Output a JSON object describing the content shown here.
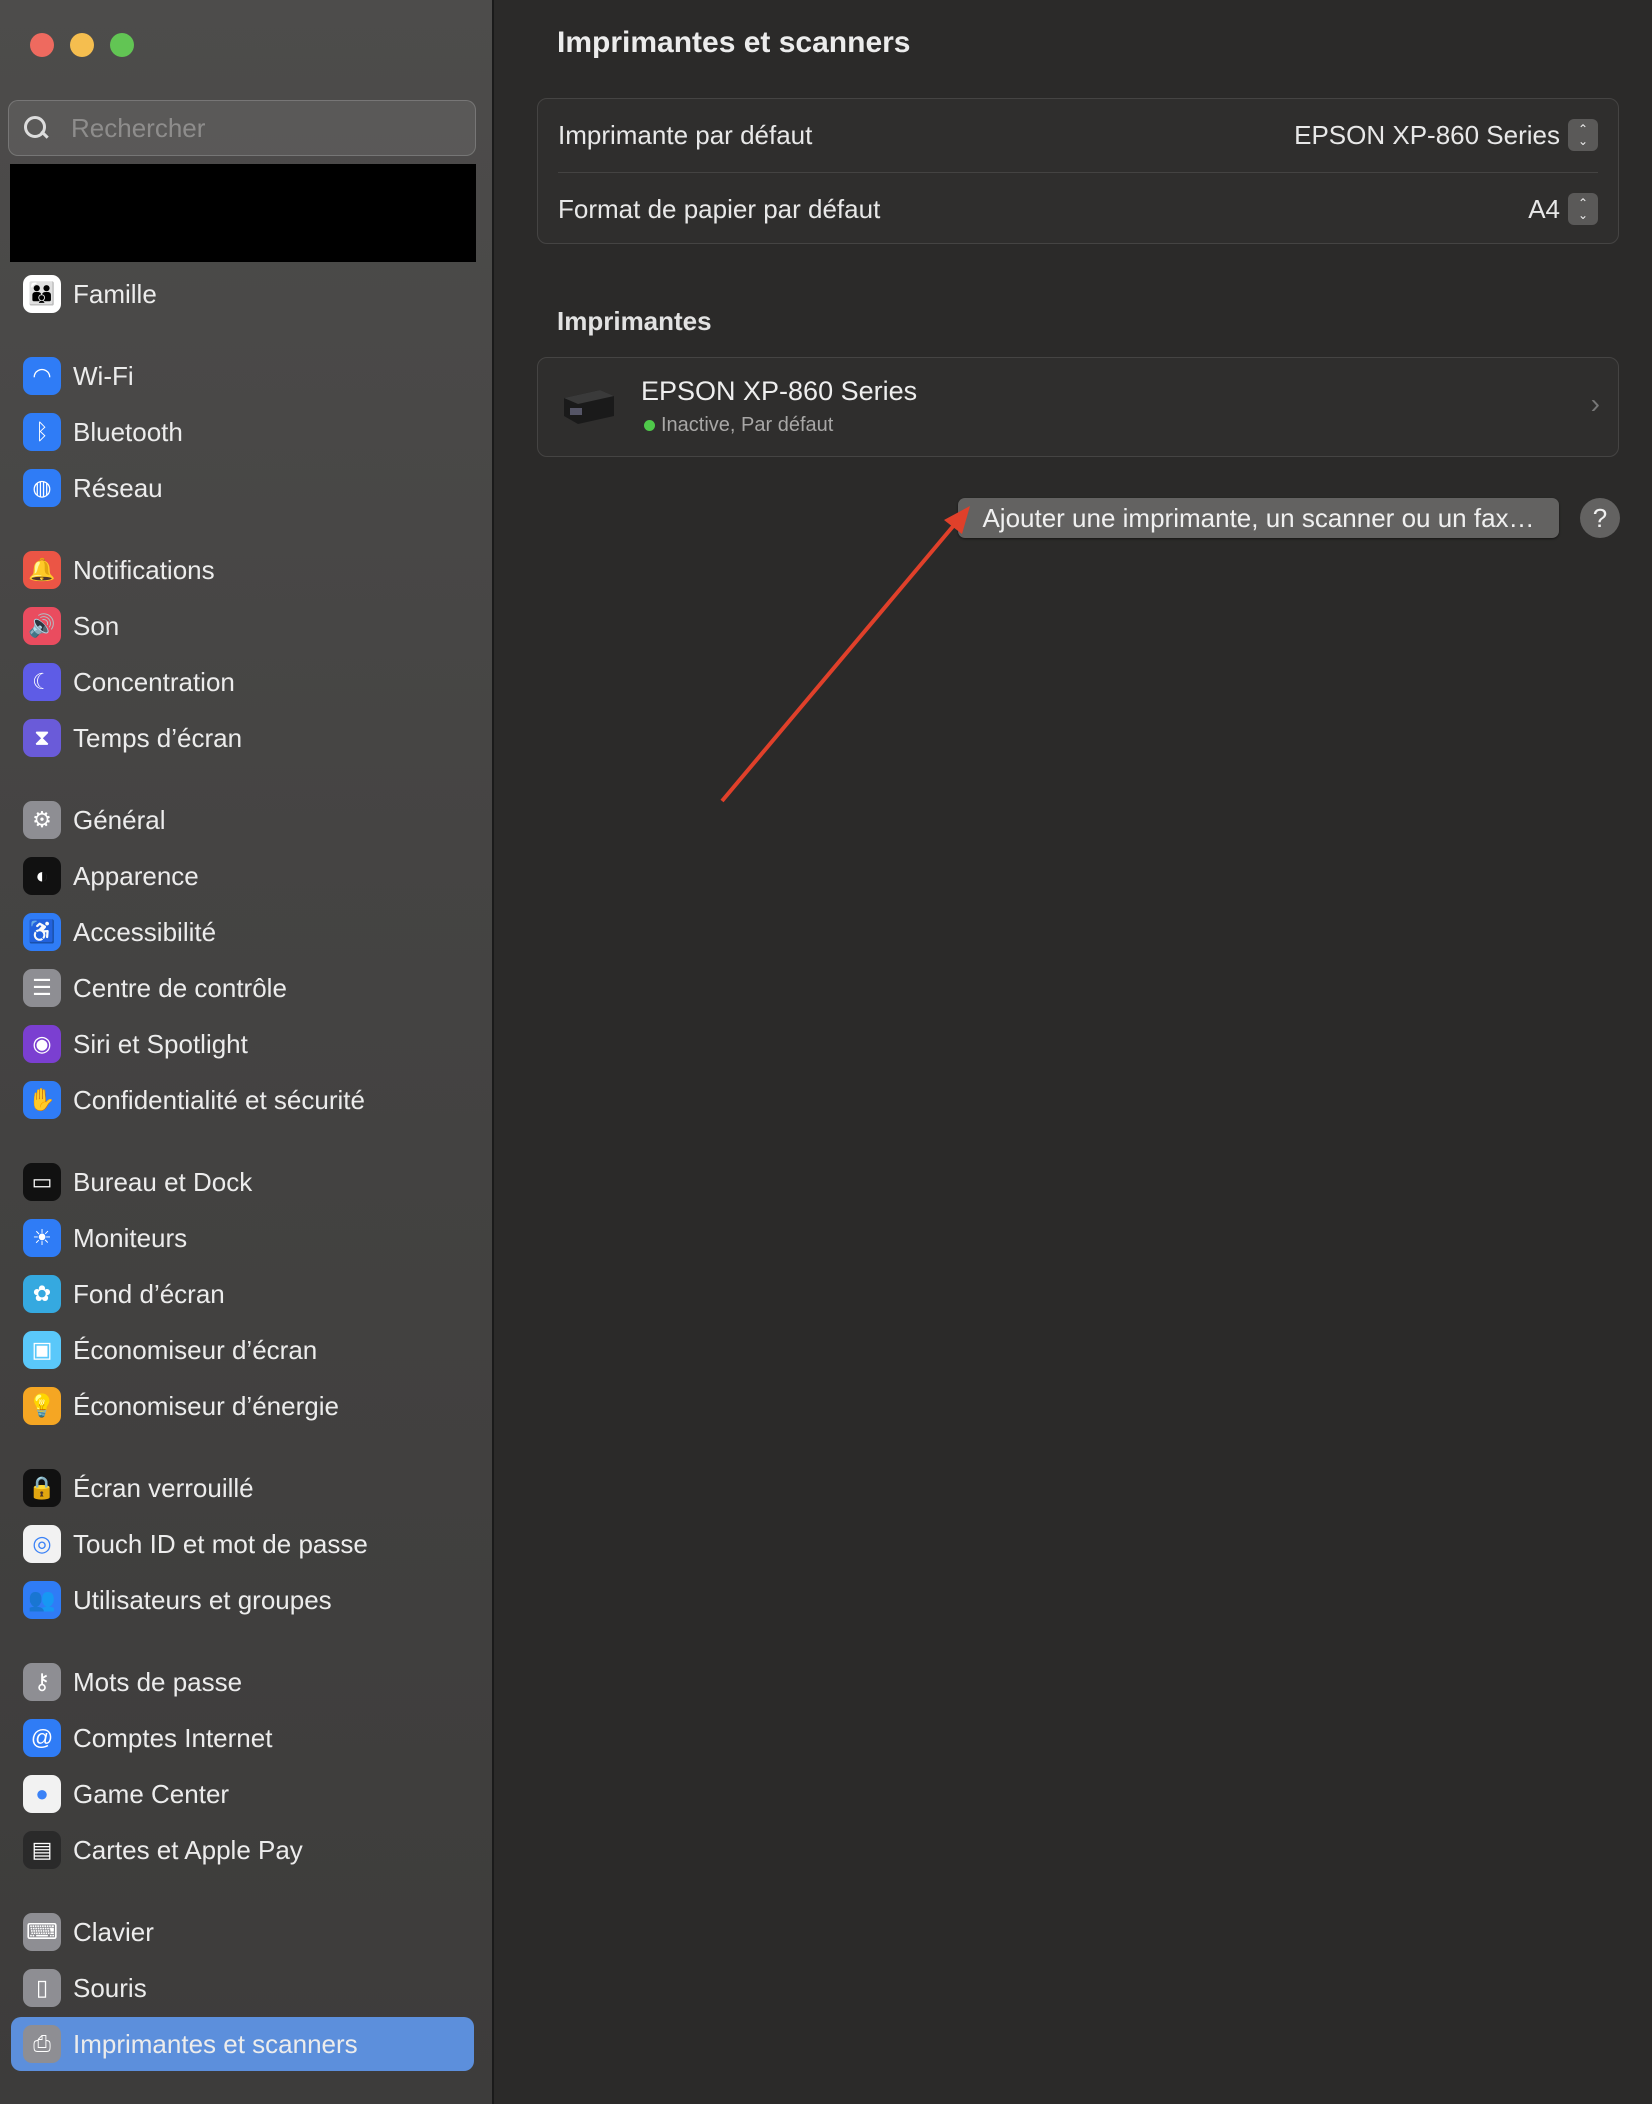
{
  "window": {
    "controls": [
      "close",
      "minimize",
      "zoom"
    ],
    "colors": {
      "close": "#ee6a5f",
      "minimize": "#f5be4f",
      "zoom": "#62c554"
    }
  },
  "search": {
    "placeholder": "Rechercher",
    "value": ""
  },
  "sidebar": {
    "items": [
      {
        "label": "Famille",
        "icon": "family-icon",
        "color": "#ffffff",
        "glyph": "👪",
        "group": 0
      },
      {
        "label": "Wi-Fi",
        "icon": "wifi-icon",
        "color": "#2f7cf6",
        "glyph": "◠",
        "group": 1
      },
      {
        "label": "Bluetooth",
        "icon": "bluetooth-icon",
        "color": "#2f7cf6",
        "glyph": "ᛒ",
        "group": 1
      },
      {
        "label": "Réseau",
        "icon": "globe-icon",
        "color": "#2f7cf6",
        "glyph": "◍",
        "group": 1
      },
      {
        "label": "Notifications",
        "icon": "bell-icon",
        "color": "#eb5545",
        "glyph": "🔔",
        "group": 2
      },
      {
        "label": "Son",
        "icon": "speaker-icon",
        "color": "#ea4c5f",
        "glyph": "🔊",
        "group": 2
      },
      {
        "label": "Concentration",
        "icon": "moon-icon",
        "color": "#5e5ce6",
        "glyph": "☾",
        "group": 2
      },
      {
        "label": "Temps d’écran",
        "icon": "hourglass-icon",
        "color": "#6a5bd9",
        "glyph": "⧗",
        "group": 2
      },
      {
        "label": "Général",
        "icon": "gear-icon",
        "color": "#8e8e93",
        "glyph": "⚙",
        "group": 3
      },
      {
        "label": "Apparence",
        "icon": "appearance-icon",
        "color": "#111111",
        "glyph": "◐",
        "group": 3
      },
      {
        "label": "Accessibilité",
        "icon": "accessibility-icon",
        "color": "#2f7cf6",
        "glyph": "♿",
        "group": 3
      },
      {
        "label": "Centre de contrôle",
        "icon": "control-center-icon",
        "color": "#8e8e93",
        "glyph": "☰",
        "group": 3
      },
      {
        "label": "Siri et Spotlight",
        "icon": "siri-icon",
        "color": "#7b3fd1",
        "glyph": "◉",
        "group": 3
      },
      {
        "label": "Confidentialité et sécurité",
        "icon": "hand-icon",
        "color": "#2f7cf6",
        "glyph": "✋",
        "group": 3
      },
      {
        "label": "Bureau et Dock",
        "icon": "dock-icon",
        "color": "#111111",
        "glyph": "▭",
        "group": 4
      },
      {
        "label": "Moniteurs",
        "icon": "display-icon",
        "color": "#2f7cf6",
        "glyph": "☀",
        "group": 4
      },
      {
        "label": "Fond d’écran",
        "icon": "wallpaper-icon",
        "color": "#35a9e0",
        "glyph": "✿",
        "group": 4
      },
      {
        "label": "Économiseur d’écran",
        "icon": "screensaver-icon",
        "color": "#5ac8fa",
        "glyph": "▣",
        "group": 4
      },
      {
        "label": "Économiseur d’énergie",
        "icon": "lightbulb-icon",
        "color": "#f5a623",
        "glyph": "💡",
        "group": 4
      },
      {
        "label": "Écran verrouillé",
        "icon": "lock-icon",
        "color": "#111111",
        "glyph": "🔒",
        "group": 5
      },
      {
        "label": "Touch ID et mot de passe",
        "icon": "fingerprint-icon",
        "color": "#f2f2f2",
        "glyph": "◎",
        "group": 5
      },
      {
        "label": "Utilisateurs et groupes",
        "icon": "users-icon",
        "color": "#2f7cf6",
        "glyph": "👥",
        "group": 5
      },
      {
        "label": "Mots de passe",
        "icon": "key-icon",
        "color": "#8e8e93",
        "glyph": "⚷",
        "group": 6
      },
      {
        "label": "Comptes Internet",
        "icon": "at-icon",
        "color": "#2f7cf6",
        "glyph": "@",
        "group": 6
      },
      {
        "label": "Game Center",
        "icon": "game-center-icon",
        "color": "#f2f2f2",
        "glyph": "●",
        "group": 6
      },
      {
        "label": "Cartes et Apple Pay",
        "icon": "wallet-icon",
        "color": "#2a2a2a",
        "glyph": "▤",
        "group": 6
      },
      {
        "label": "Clavier",
        "icon": "keyboard-icon",
        "color": "#8e8e93",
        "glyph": "⌨",
        "group": 7
      },
      {
        "label": "Souris",
        "icon": "mouse-icon",
        "color": "#8e8e93",
        "glyph": "▯",
        "group": 7
      },
      {
        "label": "Imprimantes et scanners",
        "icon": "printer-icon",
        "color": "#8e8e93",
        "glyph": "⎙",
        "group": 7,
        "selected": true
      }
    ]
  },
  "main": {
    "title": "Imprimantes et scanners",
    "defaults": [
      {
        "label": "Imprimante par défaut",
        "value": "EPSON XP-860 Series"
      },
      {
        "label": "Format de papier par défaut",
        "value": "A4"
      }
    ],
    "printers_header": "Imprimantes",
    "printers": [
      {
        "name": "EPSON XP-860 Series",
        "status": "Inactive, Par défaut",
        "status_color": "#4fc94a"
      }
    ],
    "add_button": "Ajouter une imprimante, un scanner ou un fax…",
    "help_button": "?",
    "annotation_color": "#e0402a"
  }
}
